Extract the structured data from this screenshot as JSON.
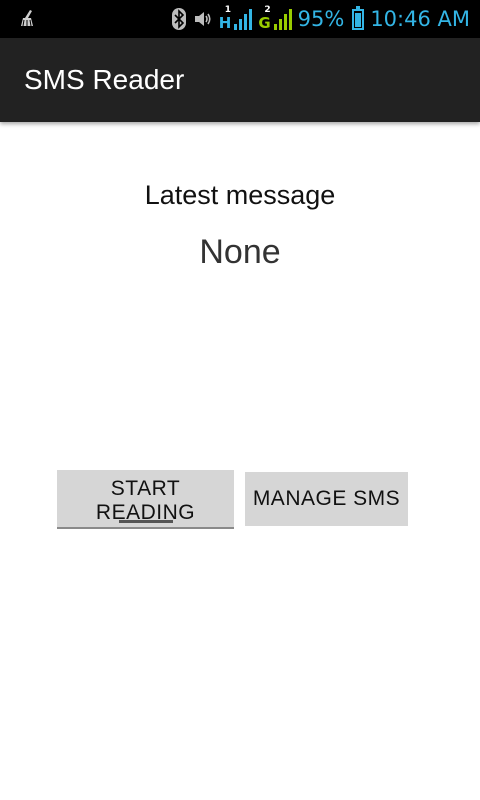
{
  "status_bar": {
    "network_1": "H",
    "network_1_tag": "1",
    "network_2": "G",
    "network_2_tag": "2",
    "battery": "95%",
    "battery_level": 0.95,
    "time": "10:46 AM",
    "icons": [
      "cleaner-icon",
      "bluetooth-icon",
      "volume-icon",
      "signal-icon",
      "battery-icon"
    ],
    "accent_color": "#33b5e5",
    "signal2_color": "#99cc00"
  },
  "action_bar": {
    "title": "SMS Reader"
  },
  "main": {
    "heading": "Latest message",
    "latest_value": "None"
  },
  "buttons": {
    "start_line1": "START",
    "start_line2": "READING",
    "manage": "MANAGE SMS"
  }
}
